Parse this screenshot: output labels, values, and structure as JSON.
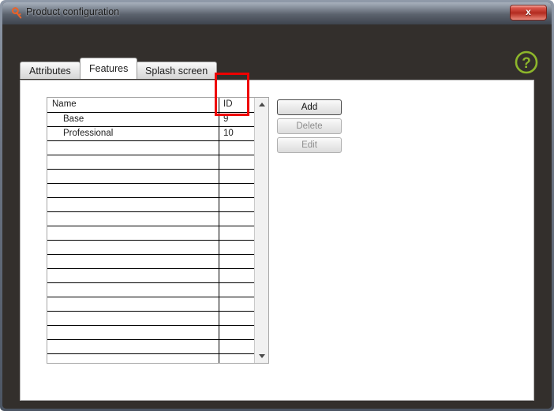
{
  "window": {
    "title": "Product configuration",
    "icon": "key-icon",
    "close_label": "x",
    "frame_color": "#332f2c",
    "titlebar_accent": "#8a939f"
  },
  "help": {
    "icon": "question-mark-icon",
    "label": "?",
    "color": "#8db62b"
  },
  "tabs": [
    {
      "label": "Attributes",
      "active": false
    },
    {
      "label": "Features",
      "active": true
    },
    {
      "label": "Splash screen",
      "active": false
    }
  ],
  "table": {
    "columns": [
      "Name",
      "ID"
    ],
    "rows": [
      {
        "name": "Base",
        "id": "9"
      },
      {
        "name": "Professional",
        "id": "10"
      }
    ],
    "empty_row_count": 16,
    "scrollbar": {
      "up_icon": "triangle-up-icon",
      "down_icon": "triangle-down-icon"
    }
  },
  "buttons": [
    {
      "label": "Add",
      "enabled": true
    },
    {
      "label": "Delete",
      "enabled": false
    },
    {
      "label": "Edit",
      "enabled": false
    }
  ],
  "annotation": {
    "color": "#ee0000",
    "target": "id-column"
  }
}
